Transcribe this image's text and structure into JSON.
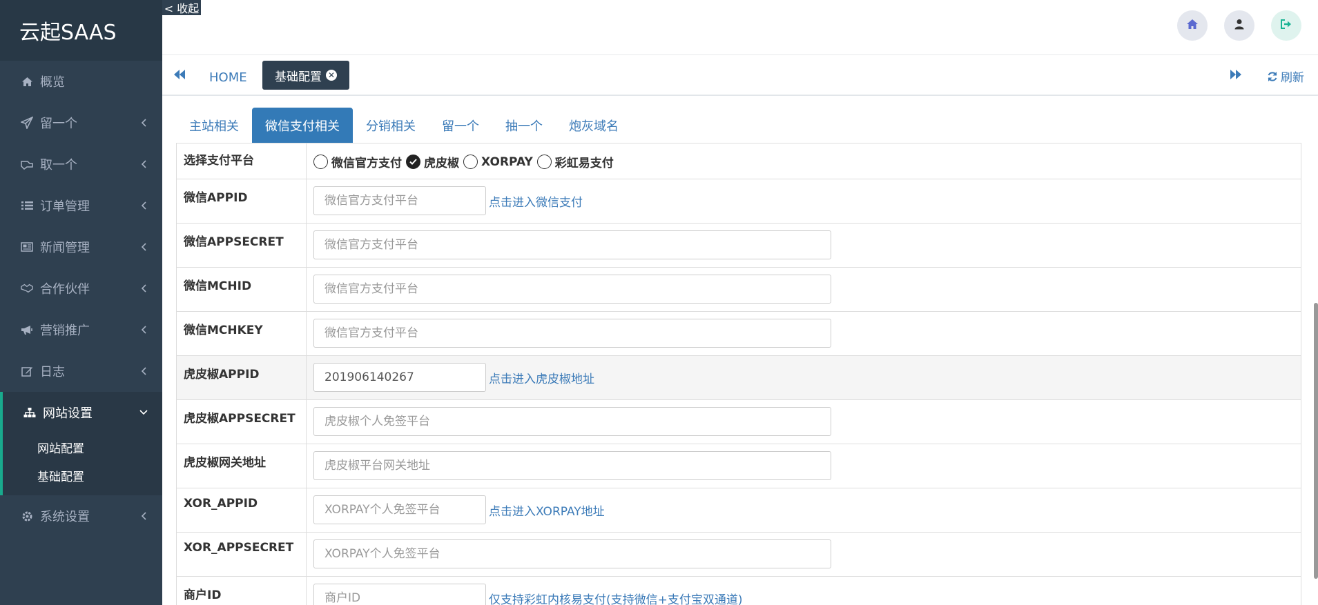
{
  "sidebar": {
    "brand": "云起SAAS",
    "items": [
      {
        "label": "概览",
        "icon": "home-icon"
      },
      {
        "label": "留一个",
        "icon": "paper-plane-icon"
      },
      {
        "label": "取一个",
        "icon": "hand-icon"
      },
      {
        "label": "订单管理",
        "icon": "list-icon"
      },
      {
        "label": "新闻管理",
        "icon": "newspaper-icon"
      },
      {
        "label": "合作伙伴",
        "icon": "handshake-icon"
      },
      {
        "label": "营销推广",
        "icon": "bullhorn-icon"
      },
      {
        "label": "日志",
        "icon": "edit-icon"
      },
      {
        "label": "网站设置",
        "icon": "sitemap-icon"
      },
      {
        "label": "系统设置",
        "icon": "gear-icon"
      }
    ],
    "sub_items": [
      "网站配置",
      "基础配置"
    ]
  },
  "collapse_label": "< 收起",
  "tabsbar": {
    "home": "HOME",
    "active_tab": "基础配置",
    "refresh": "刷新"
  },
  "subtabs": [
    "主站相关",
    "微信支付相关",
    "分销相关",
    "留一个",
    "抽一个",
    "炮灰域名"
  ],
  "form": {
    "platform_label": "选择支付平台",
    "platform_options": [
      "微信官方支付",
      "虎皮椒",
      "XORPAY",
      "彩虹易支付"
    ],
    "platform_selected": "虎皮椒",
    "rows": [
      {
        "label": "微信APPID",
        "placeholder": "微信官方支付平台",
        "value": "",
        "hint": "点击进入微信支付"
      },
      {
        "label": "微信APPSECRET",
        "placeholder": "微信官方支付平台",
        "value": "",
        "hint": ""
      },
      {
        "label": "微信MCHID",
        "placeholder": "微信官方支付平台",
        "value": "",
        "hint": ""
      },
      {
        "label": "微信MCHKEY",
        "placeholder": "微信官方支付平台",
        "value": "",
        "hint": ""
      },
      {
        "label": "虎皮椒APPID",
        "placeholder": "",
        "value": "201906140267",
        "hint": "点击进入虎皮椒地址"
      },
      {
        "label": "虎皮椒APPSECRET",
        "placeholder": "虎皮椒个人免签平台",
        "value": "",
        "hint": ""
      },
      {
        "label": "虎皮椒网关地址",
        "placeholder": "虎皮椒平台网关地址",
        "value": "",
        "hint": ""
      },
      {
        "label": "XOR_APPID",
        "placeholder": "XORPAY个人免签平台",
        "value": "",
        "hint": "点击进入XORPAY地址"
      },
      {
        "label": "XOR_APPSECRET",
        "placeholder": "XORPAY个人免签平台",
        "value": "",
        "hint": ""
      },
      {
        "label": "商户ID",
        "placeholder": "商户ID",
        "value": "",
        "hint": "仅支持彩虹内核易支付(支持微信+支付宝双通道)"
      }
    ]
  },
  "colors": {
    "sidebar_bg": "#2f4050",
    "accent": "#19aa8d",
    "link": "#3c7bb8",
    "tab_active": "#337ab7"
  }
}
